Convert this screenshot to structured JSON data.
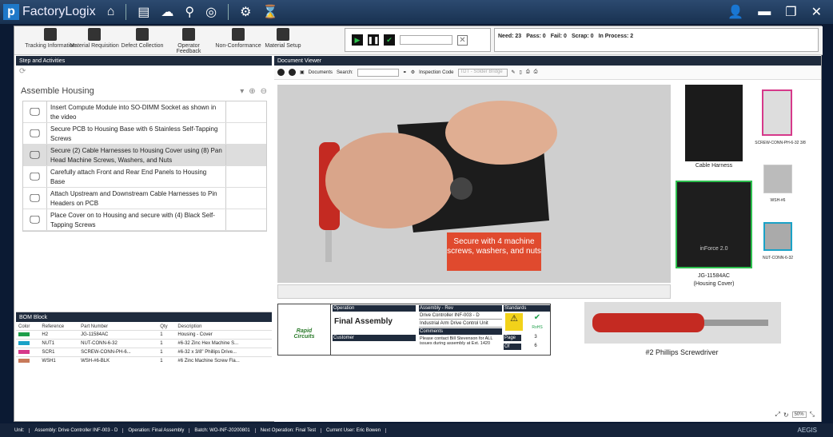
{
  "app": {
    "title": "FactoryLogix",
    "logo": "p"
  },
  "toolbar": {
    "items": [
      "Tracking Information",
      "Material Requisition",
      "Defect Collection",
      "Operator Feedback",
      "Non-Conformance",
      "Material Setup"
    ]
  },
  "stats": {
    "need": "Need: 23",
    "pass": "Pass: 0",
    "fail": "Fail: 0",
    "scrap": "Scrap: 0",
    "inprocess": "In Process: 2"
  },
  "steps_panel": {
    "title": "Step and Activities",
    "group": "Assemble Housing",
    "steps": [
      "Insert Compute Module into SO-DIMM Socket as shown in the video",
      "Secure PCB to Housing Base with 6 Stainless Self-Tapping Screws",
      "Secure (2) Cable Harnesses to Housing Cover using (8) Pan Head Machine Screws, Washers, and Nuts",
      "Carefully attach Front and Rear End Panels to Housing Base",
      "Attach Upstream and Downstream Cable Harnesses to Pin Headers on PCB",
      "Place Cover on to Housing and secure with (4) Black Self-Tapping Screws"
    ]
  },
  "bom": {
    "title": "BOM Block",
    "headers": [
      "Color",
      "Reference",
      "Part Number",
      "Qty",
      "Description"
    ],
    "rows": [
      {
        "color": "#1e9e4a",
        "ref": "H2",
        "pn": "JG-11584AC",
        "qty": "1",
        "desc": "Housing - Cover"
      },
      {
        "color": "#1aa2c7",
        "ref": "NUT1",
        "pn": "NUT-CONN-6-32",
        "qty": "1",
        "desc": "#6-32 Zinc Hex Machine S..."
      },
      {
        "color": "#d6398a",
        "ref": "SCR1",
        "pn": "SCREW-CONN-PH-6...",
        "qty": "1",
        "desc": "#6-32 x 3/8\" Phillips Drive..."
      },
      {
        "color": "#c87a5a",
        "ref": "WSH1",
        "pn": "WSH-#6-BLK",
        "qty": "1",
        "desc": "#6 Zinc Machine Screw Fla..."
      }
    ]
  },
  "viewer": {
    "title": "Document Viewer",
    "documents": "Documents",
    "search": "Search:",
    "inspection": "Inspection Code",
    "inspection_placeholder": "TDT - Solder Bridge"
  },
  "callout": "Secure with 4 machine screws, washers, and nuts",
  "thumbs": {
    "cable": "Cable Harness",
    "housing1": "JG-11584AC",
    "housing2": "(Housing Cover)",
    "screw": "SCREW-CONN-PH-6-32 3/8",
    "washer": "WSH-#6",
    "nut": "NUT-CONN-6-32",
    "screwdriver": "#2 Phillips Screwdriver",
    "inforce": "inForce 2.0"
  },
  "infotable": {
    "operation_h": "Operation",
    "operation": "Final Assembly",
    "assembly_h": "Assembly - Rev",
    "assembly": "Drive Controller INF-003 - D",
    "unit": "Industrial Arm Drive Control Unit",
    "comments_h": "Comments",
    "comments": "Please contact Bill Stevenson for ALL issues during assembly at Ext. 1420",
    "customer_h": "Customer",
    "standards_h": "Standards",
    "page_h": "Page",
    "page": "3",
    "of_h": "Of",
    "of": "6",
    "rohs": "RoHS",
    "logo1": "Rapid",
    "logo2": "Circuits"
  },
  "zoom": "50%",
  "status": {
    "unit": "Unit:",
    "assembly": "Assembly: Drive Controller INF-003 - D",
    "operation": "Operation: Final Assembly",
    "batch": "Batch: WO-INF-20200801",
    "next": "Next Operation: Final Test",
    "user": "Current User: Eric Bowen",
    "brand": "AEGIS"
  }
}
